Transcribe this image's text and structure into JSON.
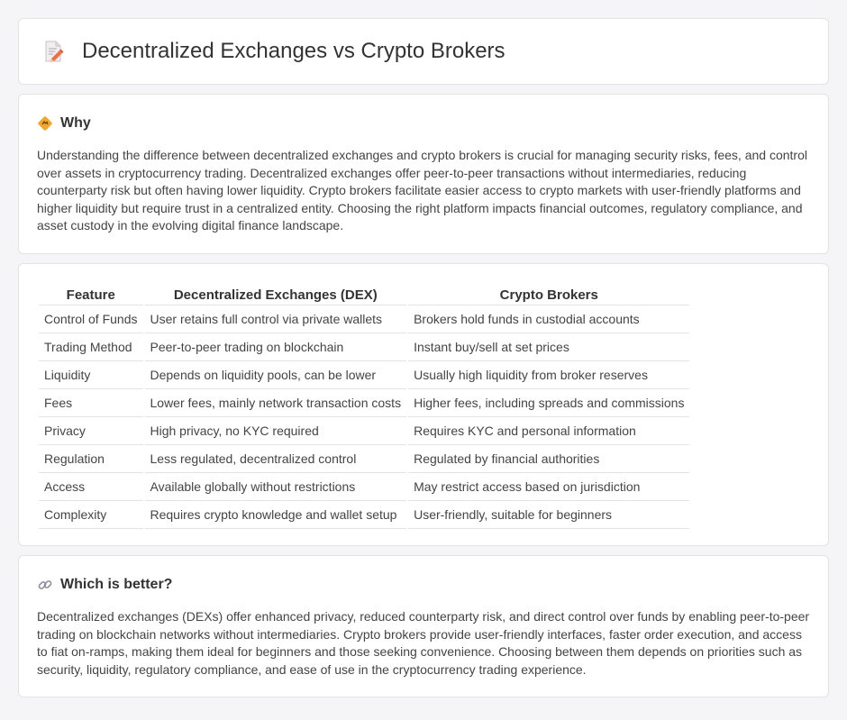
{
  "header": {
    "title": "Decentralized Exchanges vs Crypto Brokers",
    "icon": "document-pencil-icon"
  },
  "why": {
    "heading": "Why",
    "icon": "diamond-sign-icon",
    "text": "Understanding the difference between decentralized exchanges and crypto brokers is crucial for managing security risks, fees, and control over assets in cryptocurrency trading. Decentralized exchanges offer peer-to-peer transactions without intermediaries, reducing counterparty risk but often having lower liquidity. Crypto brokers facilitate easier access to crypto markets with user-friendly platforms and higher liquidity but require trust in a centralized entity. Choosing the right platform impacts financial outcomes, regulatory compliance, and asset custody in the evolving digital finance landscape."
  },
  "table": {
    "headers": [
      "Feature",
      "Decentralized Exchanges (DEX)",
      "Crypto Brokers"
    ],
    "rows": [
      [
        "Control of Funds",
        "User retains full control via private wallets",
        "Brokers hold funds in custodial accounts"
      ],
      [
        "Trading Method",
        "Peer-to-peer trading on blockchain",
        "Instant buy/sell at set prices"
      ],
      [
        "Liquidity",
        "Depends on liquidity pools, can be lower",
        "Usually high liquidity from broker reserves"
      ],
      [
        "Fees",
        "Lower fees, mainly network transaction costs",
        "Higher fees, including spreads and commissions"
      ],
      [
        "Privacy",
        "High privacy, no KYC required",
        "Requires KYC and personal information"
      ],
      [
        "Regulation",
        "Less regulated, decentralized control",
        "Regulated by financial authorities"
      ],
      [
        "Access",
        "Available globally without restrictions",
        "May restrict access based on jurisdiction"
      ],
      [
        "Complexity",
        "Requires crypto knowledge and wallet setup",
        "User-friendly, suitable for beginners"
      ]
    ]
  },
  "better": {
    "heading": "Which is better?",
    "icon": "link-icon",
    "text": "Decentralized exchanges (DEXs) offer enhanced privacy, reduced counterparty risk, and direct control over funds by enabling peer-to-peer trading on blockchain networks without intermediaries. Crypto brokers provide user-friendly interfaces, faster order execution, and access to fiat on-ramps, making them ideal for beginners and those seeking convenience. Choosing between them depends on priorities such as security, liquidity, regulatory compliance, and ease of use in the cryptocurrency trading experience."
  }
}
